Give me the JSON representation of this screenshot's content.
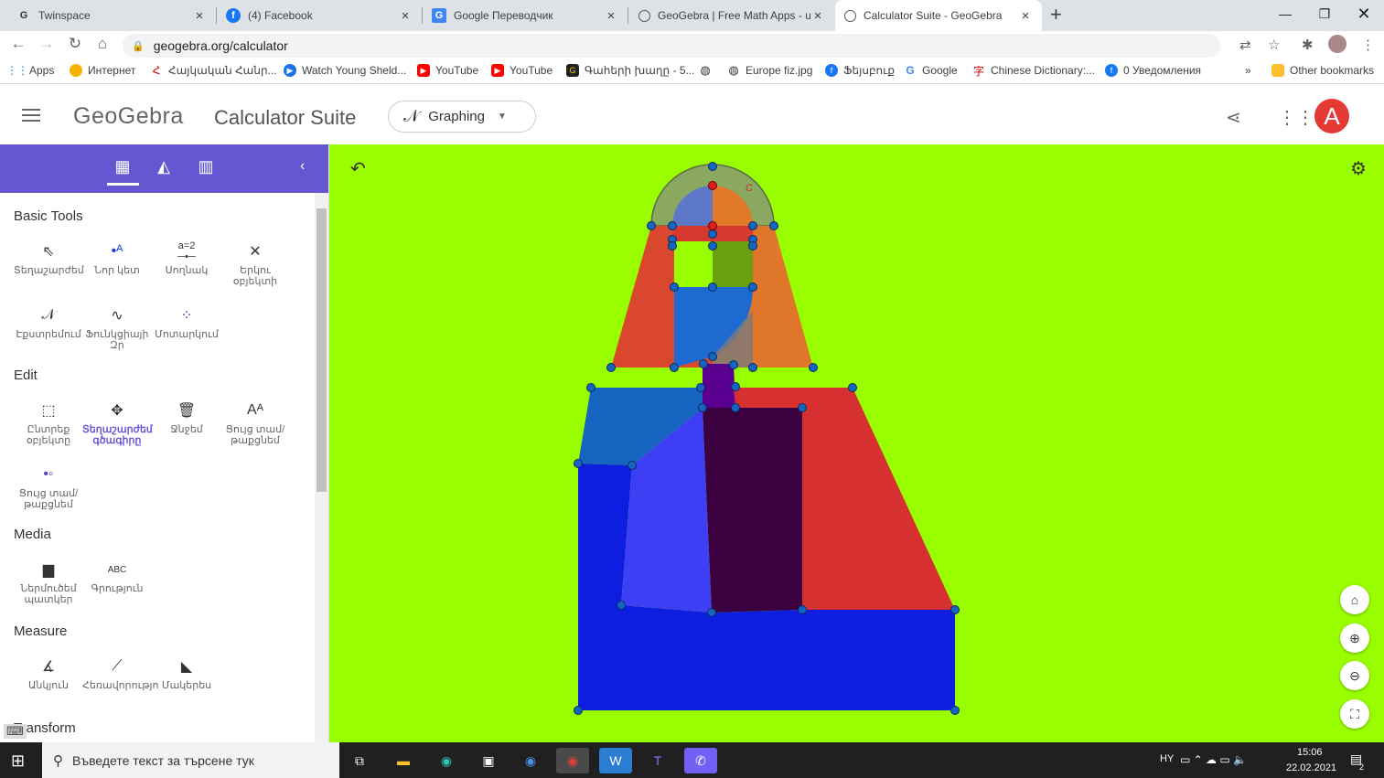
{
  "browser": {
    "tabs": [
      {
        "title": "Twinspace",
        "icon": "twinspace-icon"
      },
      {
        "title": "(4) Facebook",
        "icon": "facebook-icon"
      },
      {
        "title": "Google Переводчик",
        "icon": "translate-icon"
      },
      {
        "title": "GeoGebra | Free Math Apps - use",
        "icon": "geogebra-icon"
      },
      {
        "title": "Calculator Suite - GeoGebra",
        "icon": "geogebra-icon",
        "active": true
      }
    ],
    "url": "geogebra.org/calculator",
    "bookmarks": [
      {
        "label": "Apps",
        "icon": "apps-grid-icon"
      },
      {
        "label": "Интернет",
        "icon": "internet-icon"
      },
      {
        "label": "Հայկական Հանր...",
        "icon": "armenian-site-icon"
      },
      {
        "label": "Watch Young Sheld...",
        "icon": "play-icon"
      },
      {
        "label": "YouTube",
        "icon": "youtube-icon"
      },
      {
        "label": "YouTube",
        "icon": "youtube-icon"
      },
      {
        "label": "Գահերի խաղը - 5...",
        "icon": "site-icon"
      },
      {
        "label": "",
        "icon": "globe-icon"
      },
      {
        "label": "Europe fiz.jpg",
        "icon": "globe-icon"
      },
      {
        "label": "Ֆեյսբուք",
        "icon": "facebook-icon"
      },
      {
        "label": "Google",
        "icon": "google-icon"
      },
      {
        "label": "Chinese Dictionary:...",
        "icon": "chinese-dict-icon"
      },
      {
        "label": "0 Уведомления",
        "icon": "facebook-icon"
      }
    ],
    "more_bookmarks": "»",
    "other_bookmarks": "Other bookmarks"
  },
  "app": {
    "logo": "GeoGebra",
    "suite": "Calculator Suite",
    "app_selector": "Graphing",
    "avatar_letter": "A"
  },
  "panel": {
    "sections": [
      {
        "title": "Basic Tools",
        "tools": [
          {
            "label": "Տեղաշարժեմ",
            "icon": "move-arrow-icon"
          },
          {
            "label": "Նոր կետ",
            "icon": "point-icon"
          },
          {
            "label": "Սողնակ",
            "icon": "slider-icon"
          },
          {
            "label": "Երկու օբյեկտի",
            "icon": "intersect-icon"
          },
          {
            "label": "Էքստրեմում",
            "icon": "extremum-icon"
          },
          {
            "label": "Ֆունկցիայի Զր",
            "icon": "roots-icon"
          },
          {
            "label": "Մոտարկում",
            "icon": "fit-line-icon"
          }
        ]
      },
      {
        "title": "Edit",
        "tools": [
          {
            "label": "Ընտրեք օբյեկտը",
            "icon": "select-icon"
          },
          {
            "label": "Տեղաշարժեմ գծագիրը",
            "icon": "move-graphics-icon",
            "selected": true
          },
          {
            "label": "Ջնջեմ",
            "icon": "delete-icon"
          },
          {
            "label": "Ցույց տամ/ թաքցնեմ",
            "icon": "show-label-icon"
          },
          {
            "label": "Ցույց տամ/ թաքցնեմ",
            "icon": "show-object-icon"
          }
        ]
      },
      {
        "title": "Media",
        "tools": [
          {
            "label": "Ներմուծեմ պատկեր",
            "icon": "image-icon"
          },
          {
            "label": "Գրություն",
            "icon": "text-icon",
            "glyph": "ABC"
          }
        ]
      },
      {
        "title": "Measure",
        "tools": [
          {
            "label": "Անկյուն",
            "icon": "angle-icon"
          },
          {
            "label": "Հեռավորությո",
            "icon": "distance-icon"
          },
          {
            "label": "Մակերես",
            "icon": "area-icon"
          }
        ]
      },
      {
        "title": "Transform",
        "tools": []
      }
    ]
  },
  "canvas": {
    "background": "#99ff00",
    "point_label": "C",
    "colors": {
      "red": "#d63a2e",
      "orange": "#e0762a",
      "blue": "#1565c0",
      "navy": "#0d1ee0",
      "purple": "#3a0040",
      "violet": "#5a0090"
    }
  },
  "taskbar": {
    "search_placeholder": "Въведете текст за търсене тук",
    "lang": "HY",
    "time": "15:06",
    "date": "22.02.2021",
    "notif_count": "2"
  }
}
